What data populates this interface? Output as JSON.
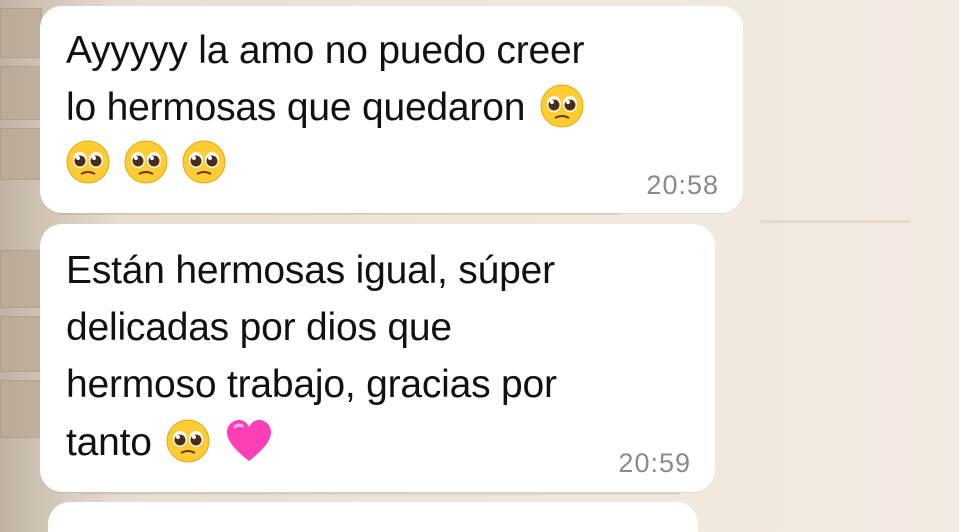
{
  "chat": {
    "messages": [
      {
        "lines": [
          "Ayyyyy la amo no puedo creer",
          "lo hermosas que quedaron"
        ],
        "emoji_row": [
          "pleading-face",
          "pleading-face",
          "pleading-face"
        ],
        "time": "20:58"
      },
      {
        "lines": [
          "Están hermosas igual, súper",
          "delicadas por dios que",
          "hermoso trabajo, gracias por",
          "tanto"
        ],
        "time": "20:59"
      }
    ]
  },
  "icons": {
    "pleading_face": "pleading-face-emoji",
    "pink_heart": "pink-heart-emoji"
  },
  "colors": {
    "bubble": "#ffffff",
    "text": "#111111",
    "timestamp": "#8a8a8a",
    "heart": "#ff3fb3",
    "emoji_face": "#ffcc33"
  }
}
